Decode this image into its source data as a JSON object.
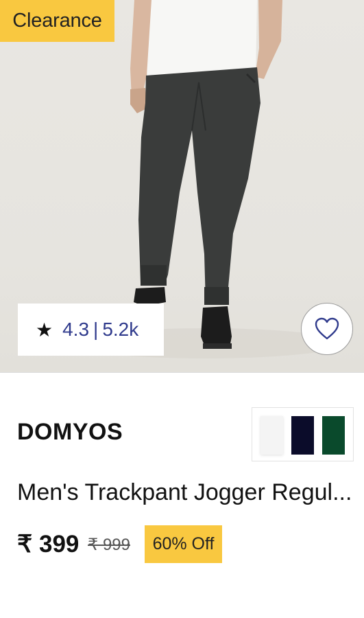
{
  "product_card": {
    "badge_label": "Clearance",
    "rating": {
      "star_icon": "★",
      "value": "4.3",
      "separator": "|",
      "count": "5.2k"
    },
    "wishlist_icon": "heart-icon",
    "brand": "DOMYOS",
    "name": "Men's Trackpant Jogger Regul...",
    "price": "₹ 399",
    "mrp": "₹ 999",
    "discount_label": "60% Off",
    "color_swatches": [
      {
        "name": "white",
        "color": "#f4f4f4"
      },
      {
        "name": "navy",
        "color": "#0b0c2a"
      },
      {
        "name": "green",
        "color": "#0a4a2c"
      }
    ]
  },
  "colors": {
    "accent_yellow": "#f9c840",
    "rating_text": "#2f3a8c"
  }
}
